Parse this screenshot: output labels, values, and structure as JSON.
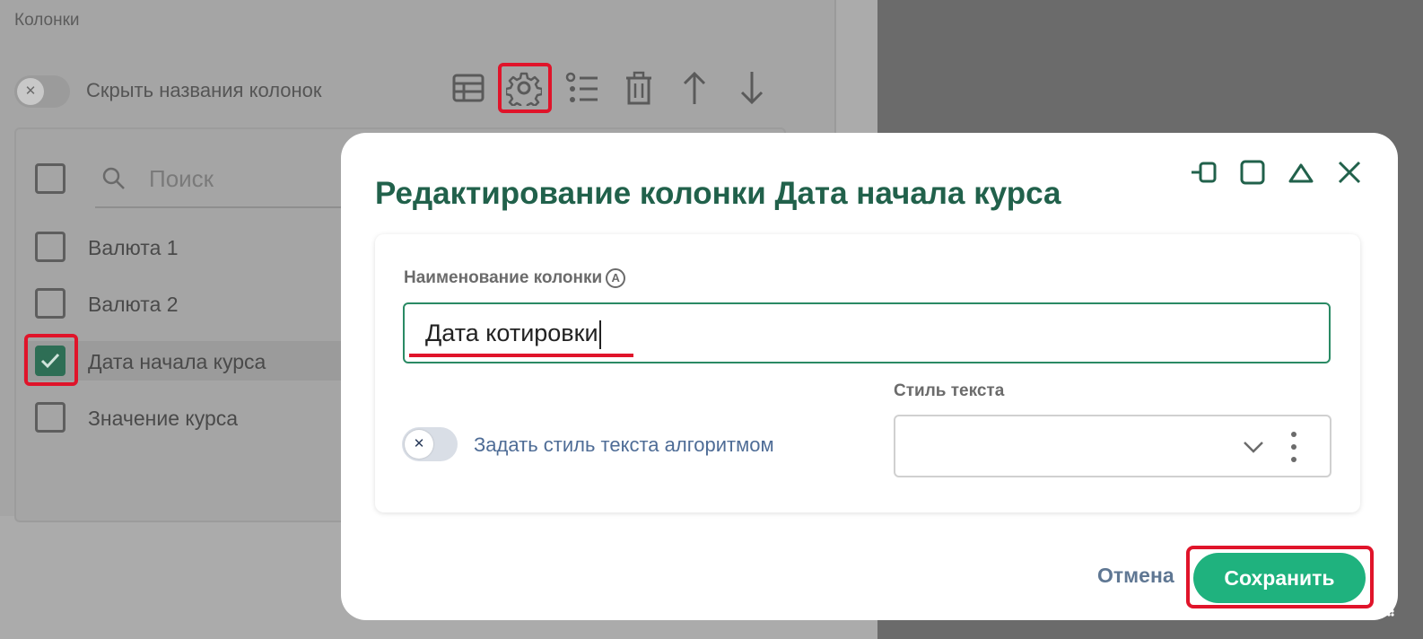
{
  "panel": {
    "title": "Колонки",
    "hide_names_label": "Скрыть названия колонок",
    "search_placeholder": "Поиск",
    "columns": [
      {
        "label": "Валюта 1",
        "checked": false
      },
      {
        "label": "Валюта 2",
        "checked": false
      },
      {
        "label": "Дата начала курса",
        "checked": true
      },
      {
        "label": "Значение курса",
        "checked": false
      }
    ],
    "toolbar_icons": [
      "table-icon",
      "gear-icon",
      "list-settings-icon",
      "trash-icon",
      "arrow-up-icon",
      "arrow-down-icon"
    ]
  },
  "dialog": {
    "title": "Редактирование колонки Дата начала курса",
    "window_controls": [
      "dock-icon",
      "maximize-icon",
      "collapse-icon",
      "close-icon"
    ],
    "name_label": "Наименование колонки",
    "name_value": "Дата котировки",
    "style_label": "Стиль текста",
    "algo_toggle_label": "Задать стиль текста алгоритмом",
    "style_value": "",
    "cancel_label": "Отмена",
    "save_label": "Сохранить"
  },
  "colors": {
    "accent": "#1fb27e",
    "title": "#21614b",
    "highlight": "#e0142a"
  }
}
